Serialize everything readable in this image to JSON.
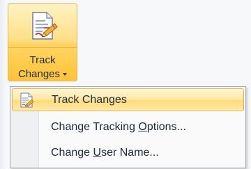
{
  "ribbon_button": {
    "label_line1": "Track",
    "label_line2": "Changes",
    "icon": "track-changes-icon",
    "accent": "#ffd15a"
  },
  "menu": {
    "items": [
      {
        "pre": "Track Chan",
        "accel": "g",
        "post": "es",
        "icon": "track-changes-icon",
        "highlighted": true
      },
      {
        "pre": "Change Tracking ",
        "accel": "O",
        "post": "ptions...",
        "icon": "",
        "highlighted": false
      },
      {
        "pre": "Change ",
        "accel": "U",
        "post": "ser Name...",
        "icon": "",
        "highlighted": false
      }
    ]
  }
}
